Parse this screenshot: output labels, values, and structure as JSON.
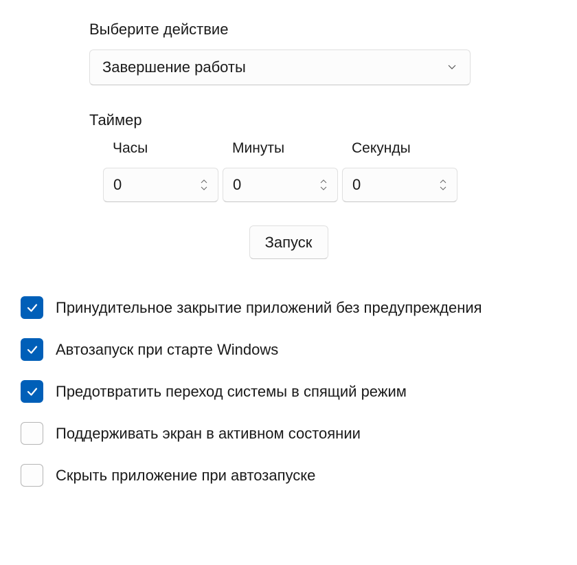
{
  "action": {
    "label": "Выберите действие",
    "value": "Завершение работы"
  },
  "timer": {
    "label": "Таймер",
    "columns": [
      {
        "label": "Часы",
        "value": "0"
      },
      {
        "label": "Минуты",
        "value": "0"
      },
      {
        "label": "Секунды",
        "value": "0"
      }
    ]
  },
  "run_button": "Запуск",
  "options": [
    {
      "label": "Принудительное закрытие приложений без предупреждения",
      "checked": true
    },
    {
      "label": "Автозапуск при старте Windows",
      "checked": true
    },
    {
      "label": "Предотвратить переход системы в спящий режим",
      "checked": true
    },
    {
      "label": "Поддерживать экран в активном состоянии",
      "checked": false
    },
    {
      "label": "Скрыть приложение при автозапуске",
      "checked": false
    }
  ]
}
